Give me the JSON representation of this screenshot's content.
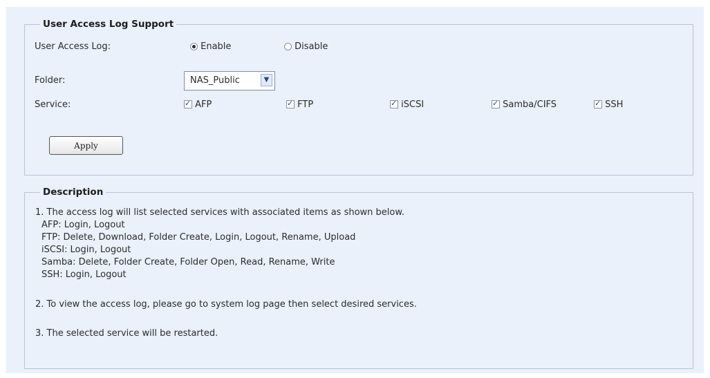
{
  "access_log": {
    "legend": "User Access Log Support",
    "log_label": "User Access Log:",
    "enable_label": "Enable",
    "disable_label": "Disable",
    "selected": "Enable",
    "folder_label": "Folder:",
    "folder_value": "NAS_Public",
    "service_label": "Service:",
    "services": [
      {
        "label": "AFP",
        "checked": true
      },
      {
        "label": "FTP",
        "checked": true
      },
      {
        "label": "iSCSI",
        "checked": true
      },
      {
        "label": "Samba/CIFS",
        "checked": true
      },
      {
        "label": "SSH",
        "checked": true
      }
    ],
    "apply_label": "Apply"
  },
  "description": {
    "legend": "Description",
    "lines": [
      "1. The access log will list selected services with associated items as shown below.",
      "AFP: Login, Logout",
      "FTP: Delete, Download, Folder Create, Login, Logout, Rename, Upload",
      "iSCSI: Login, Logout",
      "Samba: Delete, Folder Create, Folder Open, Read, Rename, Write",
      "SSH: Login, Logout",
      "2. To view the access log, please go to system log page then select desired services.",
      "3. The selected service will be restarted."
    ]
  }
}
